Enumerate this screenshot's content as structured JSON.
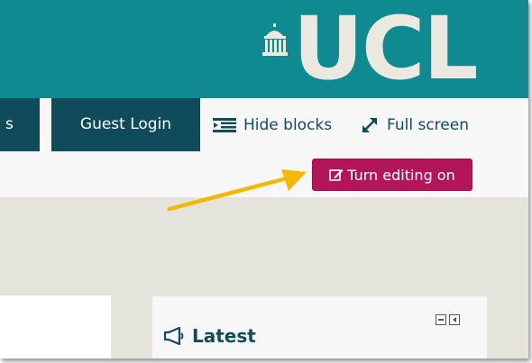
{
  "header": {
    "logo_text": "UCL",
    "colors": {
      "background": "#0f8a91",
      "logo": "#ebe8e0"
    }
  },
  "navbar": {
    "left_tab_label": "s",
    "guest_login_label": "Guest Login",
    "hide_blocks_label": "Hide blocks",
    "full_screen_label": "Full screen",
    "icons": {
      "hide_blocks": "hide-blocks-icon",
      "full_screen": "expand-arrows-icon"
    },
    "colors": {
      "tab": "#0f4b5a",
      "action_text": "#0f4b5a"
    }
  },
  "editing": {
    "button_label": "Turn editing on",
    "icon": "edit-icon",
    "color": "#b3155a"
  },
  "block": {
    "title": "Latest",
    "icon": "megaphone-icon",
    "controls": [
      "minimize-icon",
      "dock-icon"
    ]
  },
  "annotation": {
    "color": "#f5b800",
    "icon": "arrow-icon"
  }
}
